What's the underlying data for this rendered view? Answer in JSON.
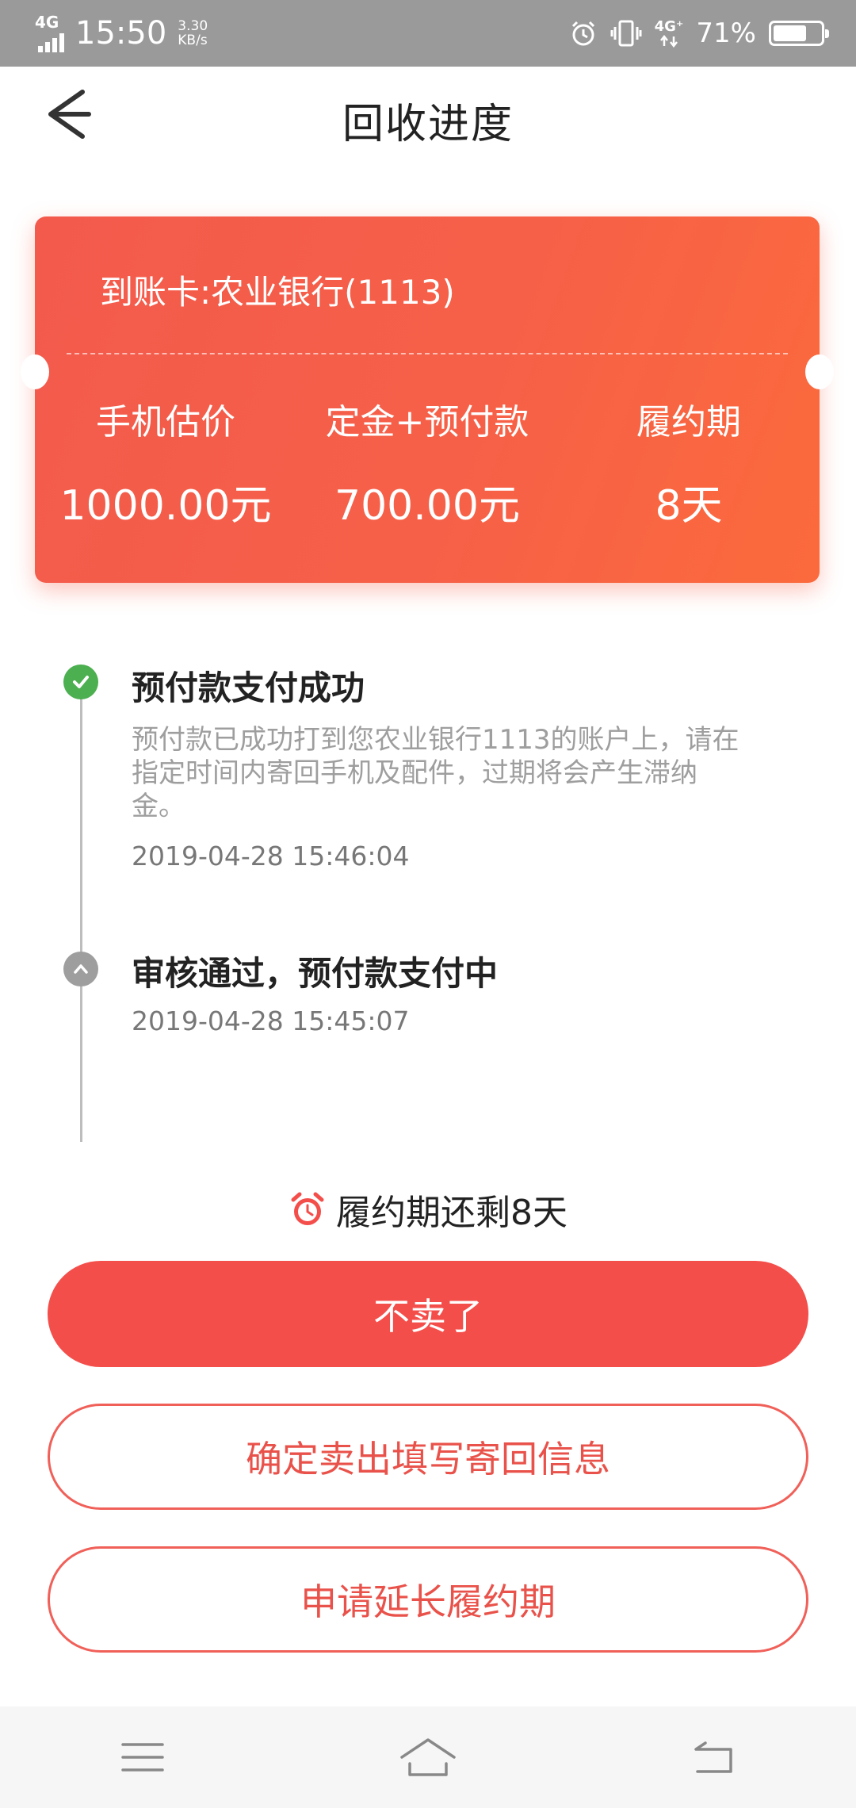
{
  "status_bar": {
    "network": "4G",
    "time": "15:50",
    "speed_value": "3.30",
    "speed_unit": "KB/s",
    "network_right": "4G⁺",
    "battery_percent": "71%",
    "battery_level": 0.71
  },
  "header": {
    "title": "回收进度"
  },
  "card": {
    "bank_label": "到账卡:农业银行(1113)",
    "columns": [
      {
        "label": "手机估价",
        "value": "1000.00元"
      },
      {
        "label": "定金+预付款",
        "value": "700.00元"
      },
      {
        "label": "履约期",
        "value": "8天"
      }
    ]
  },
  "timeline": {
    "steps": [
      {
        "title": "预付款支付成功",
        "desc": "预付款已成功打到您农业银行1113的账户上，请在指定时间内寄回手机及配件，过期将会产生滞纳金。",
        "time": "2019-04-28 15:46:04",
        "status": "done"
      },
      {
        "title": "审核通过，预付款支付中",
        "time": "2019-04-28 15:45:07",
        "status": "pending"
      }
    ]
  },
  "countdown": {
    "text": "履约期还剩8天"
  },
  "buttons": {
    "cancel": "不卖了",
    "confirm": "确定卖出填写寄回信息",
    "extend": "申请延长履约期"
  },
  "colors": {
    "accent": "#f44e4b",
    "success": "#4caf50",
    "pending": "#9e9e9e"
  }
}
